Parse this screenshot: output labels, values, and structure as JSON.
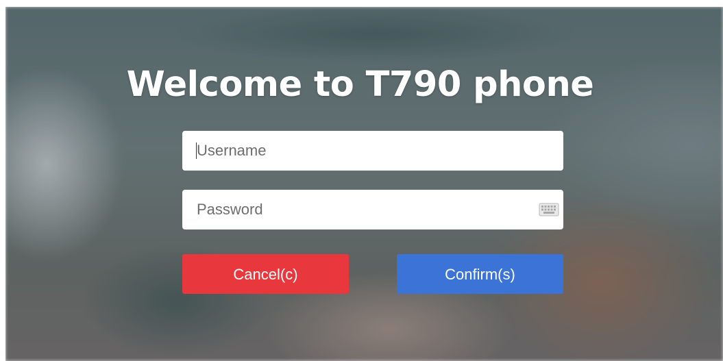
{
  "app": {
    "title": "Welcome to T790 phone"
  },
  "login": {
    "username": {
      "value": "",
      "placeholder": "Username"
    },
    "password": {
      "value": "",
      "placeholder": "Password",
      "icon": "keyboard-icon"
    },
    "cancel_label": "Cancel(c)",
    "confirm_label": "Confirm(s)"
  },
  "colors": {
    "cancel_button": "#e8383e",
    "confirm_button": "#3b73d6",
    "title_text": "#ffffff"
  }
}
